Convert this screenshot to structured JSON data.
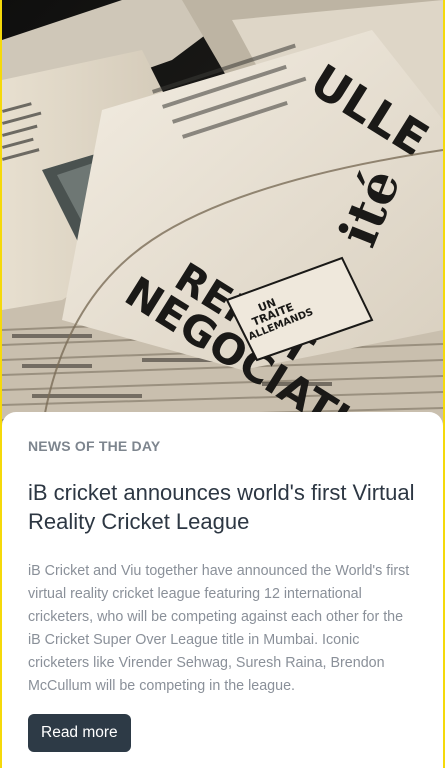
{
  "hero": {
    "image_subject": "stack of old newspapers",
    "headline_left": "NEGOCIATION",
    "headline_right": "REMET",
    "masthead_fragment": "ULLE",
    "small_line_1": "UN",
    "small_line_2": "TRAITE",
    "small_line_3": "ALLEMANDS",
    "title_fragment": "ité"
  },
  "article": {
    "kicker": "NEWS OF THE DAY",
    "title": "iB cricket announces world's first Virtual Reality Cricket League",
    "summary": "iB Cricket and Viu together have announced the World's first virtual reality cricket league featuring 12 international cricketers, who will be competing against each other for the iB Cricket Super Over League title in Mumbai. Iconic cricketers like Virender Sehwag, Suresh Raina, Brendon McCullum will be competing in the league.",
    "cta_label": "Read more"
  },
  "colors": {
    "frame_border": "#f5d90a",
    "button_bg": "#2d3a46",
    "kicker": "#7d858e",
    "title": "#2d3743",
    "summary": "#8a9099"
  }
}
